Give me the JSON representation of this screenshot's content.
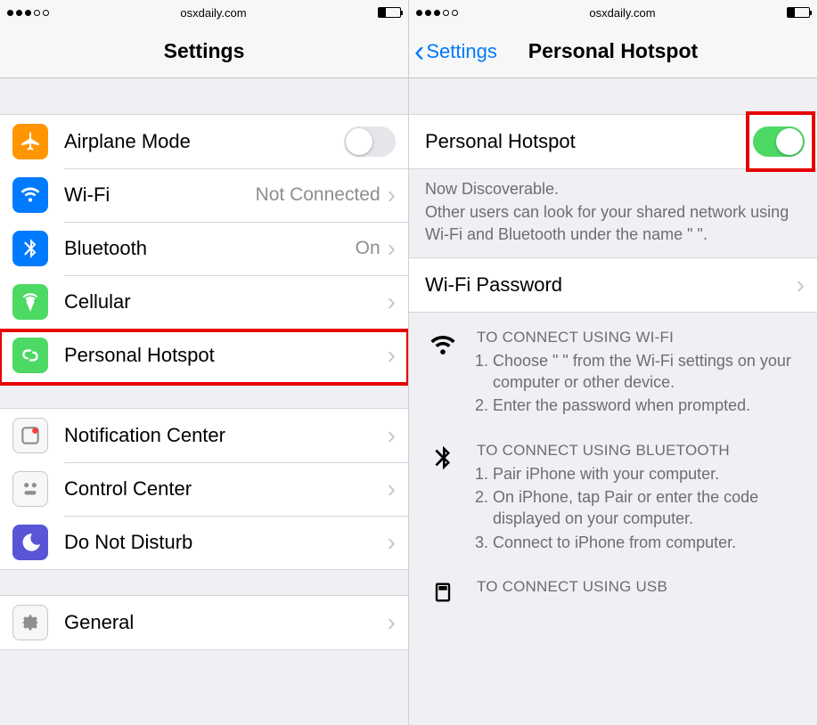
{
  "status": {
    "carrier_dots": 5,
    "signal_filled": 3,
    "url": "osxdaily.com"
  },
  "left": {
    "title": "Settings",
    "rows": {
      "airplane": {
        "label": "Airplane Mode",
        "toggle_on": false
      },
      "wifi": {
        "label": "Wi-Fi",
        "value": "Not Connected"
      },
      "bluetooth": {
        "label": "Bluetooth",
        "value": "On"
      },
      "cellular": {
        "label": "Cellular"
      },
      "hotspot": {
        "label": "Personal Hotspot"
      },
      "notif": {
        "label": "Notification Center"
      },
      "control": {
        "label": "Control Center"
      },
      "dnd": {
        "label": "Do Not Disturb"
      },
      "general": {
        "label": "General"
      }
    }
  },
  "right": {
    "back": "Settings",
    "title": "Personal Hotspot",
    "toggle": {
      "label": "Personal Hotspot",
      "on": true
    },
    "discoverable_title": "Now Discoverable.",
    "discoverable_body": "Other users can look for your shared network using Wi-Fi and Bluetooth under the name \"                       \".",
    "wifi_pw_label": "Wi-Fi Password",
    "wifi": {
      "header": "TO CONNECT USING WI-FI",
      "step1": "Choose \"                        \" from the Wi-Fi settings on your computer or other device.",
      "step2": "Enter the password when prompted."
    },
    "bt": {
      "header": "TO CONNECT USING BLUETOOTH",
      "step1": "Pair iPhone with your computer.",
      "step2": "On iPhone, tap Pair or enter the code displayed on your computer.",
      "step3": "Connect to iPhone from computer."
    },
    "usb": {
      "header": "TO CONNECT USING USB"
    }
  }
}
